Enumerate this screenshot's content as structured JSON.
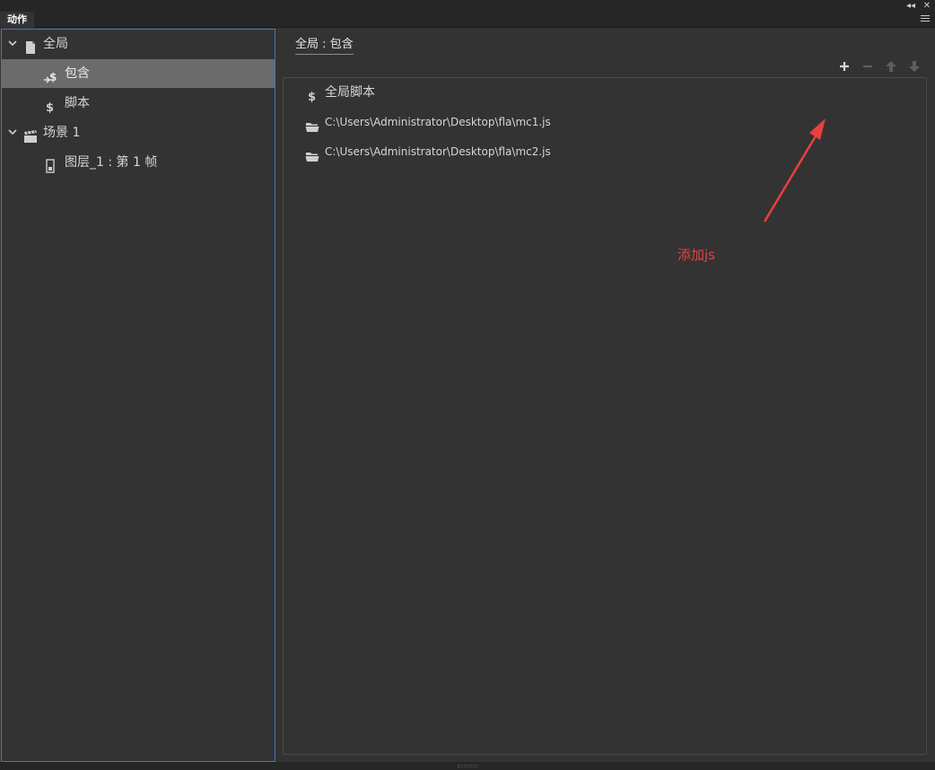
{
  "panel": {
    "tab_label": "动作",
    "collapse_glyph": "◂◂",
    "close_glyph": "✕"
  },
  "tree": {
    "items": [
      {
        "label": "全局",
        "icon": "document-icon",
        "expanded": true
      },
      {
        "label": "包含",
        "icon": "include-script-icon",
        "selected": true
      },
      {
        "label": "脚本",
        "icon": "script-icon"
      },
      {
        "label": "场景 1",
        "icon": "clapperboard-icon",
        "expanded": true
      },
      {
        "label": "图层_1 : 第 1 帧",
        "icon": "layer-frame-icon"
      }
    ]
  },
  "right": {
    "breadcrumb": "全局 : 包含",
    "toolbar": {
      "add": "+",
      "remove": "−"
    },
    "list": [
      {
        "label": "全局脚本",
        "icon": "script-icon"
      },
      {
        "label": "C:\\Users\\Administrator\\Desktop\\fla\\mc1.js",
        "icon": "folder-icon"
      },
      {
        "label": "C:\\Users\\Administrator\\Desktop\\fla\\mc2.js",
        "icon": "folder-icon"
      }
    ]
  },
  "annotation": {
    "text": "添加js",
    "color": "#e8413c"
  },
  "colors": {
    "background": "#333333",
    "selection": "#6b6b6b",
    "focus_border": "#3a78c9"
  }
}
